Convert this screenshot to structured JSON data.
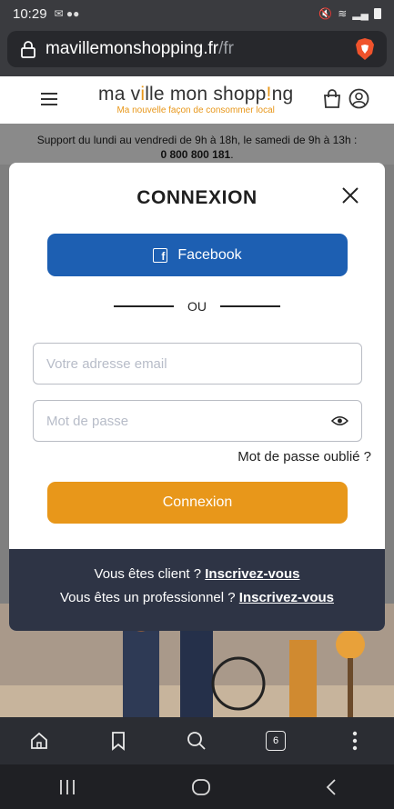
{
  "status_bar": {
    "time": "10:29",
    "notifications": "✉ ●●"
  },
  "browser": {
    "url_domain": "mavillemonshopping.fr",
    "url_path": "/fr",
    "tab_count": "6"
  },
  "site": {
    "logo_main_left": "ma v",
    "logo_main_hl": "i",
    "logo_main_right": "lle mon shopp",
    "logo_main_hl2": "!",
    "logo_main_end": "ng",
    "logo_tagline": "Ma nouvelle façon de consommer local",
    "support_text": "Support du lundi au vendredi de 9h à 18h, le samedi de 9h à 13h :",
    "support_phone": "0 800 800 181",
    "support_phone_suffix": "."
  },
  "modal": {
    "title": "CONNEXION",
    "facebook_label": "Facebook",
    "separator": "OU",
    "email_placeholder": "Votre adresse email",
    "password_placeholder": "Mot de passe",
    "forgot_label": "Mot de passe oublié ?",
    "login_label": "Connexion",
    "footer_client_text": "Vous êtes client ?",
    "footer_client_link": "Inscrivez-vous",
    "footer_pro_text": "Vous êtes un professionnel ?",
    "footer_pro_link": "Inscrivez-vous"
  },
  "colors": {
    "brand_orange": "#e8971a",
    "facebook_blue": "#1d5fb2",
    "footer_navy": "#2e3445"
  },
  "icons": [
    "lock-icon",
    "brave-icon",
    "menu-icon",
    "cart-icon",
    "user-icon",
    "close-icon",
    "facebook-icon",
    "eye-icon",
    "home-icon",
    "bookmark-icon",
    "search-icon",
    "more-icon",
    "recents-icon",
    "home-nav-icon",
    "back-icon"
  ]
}
